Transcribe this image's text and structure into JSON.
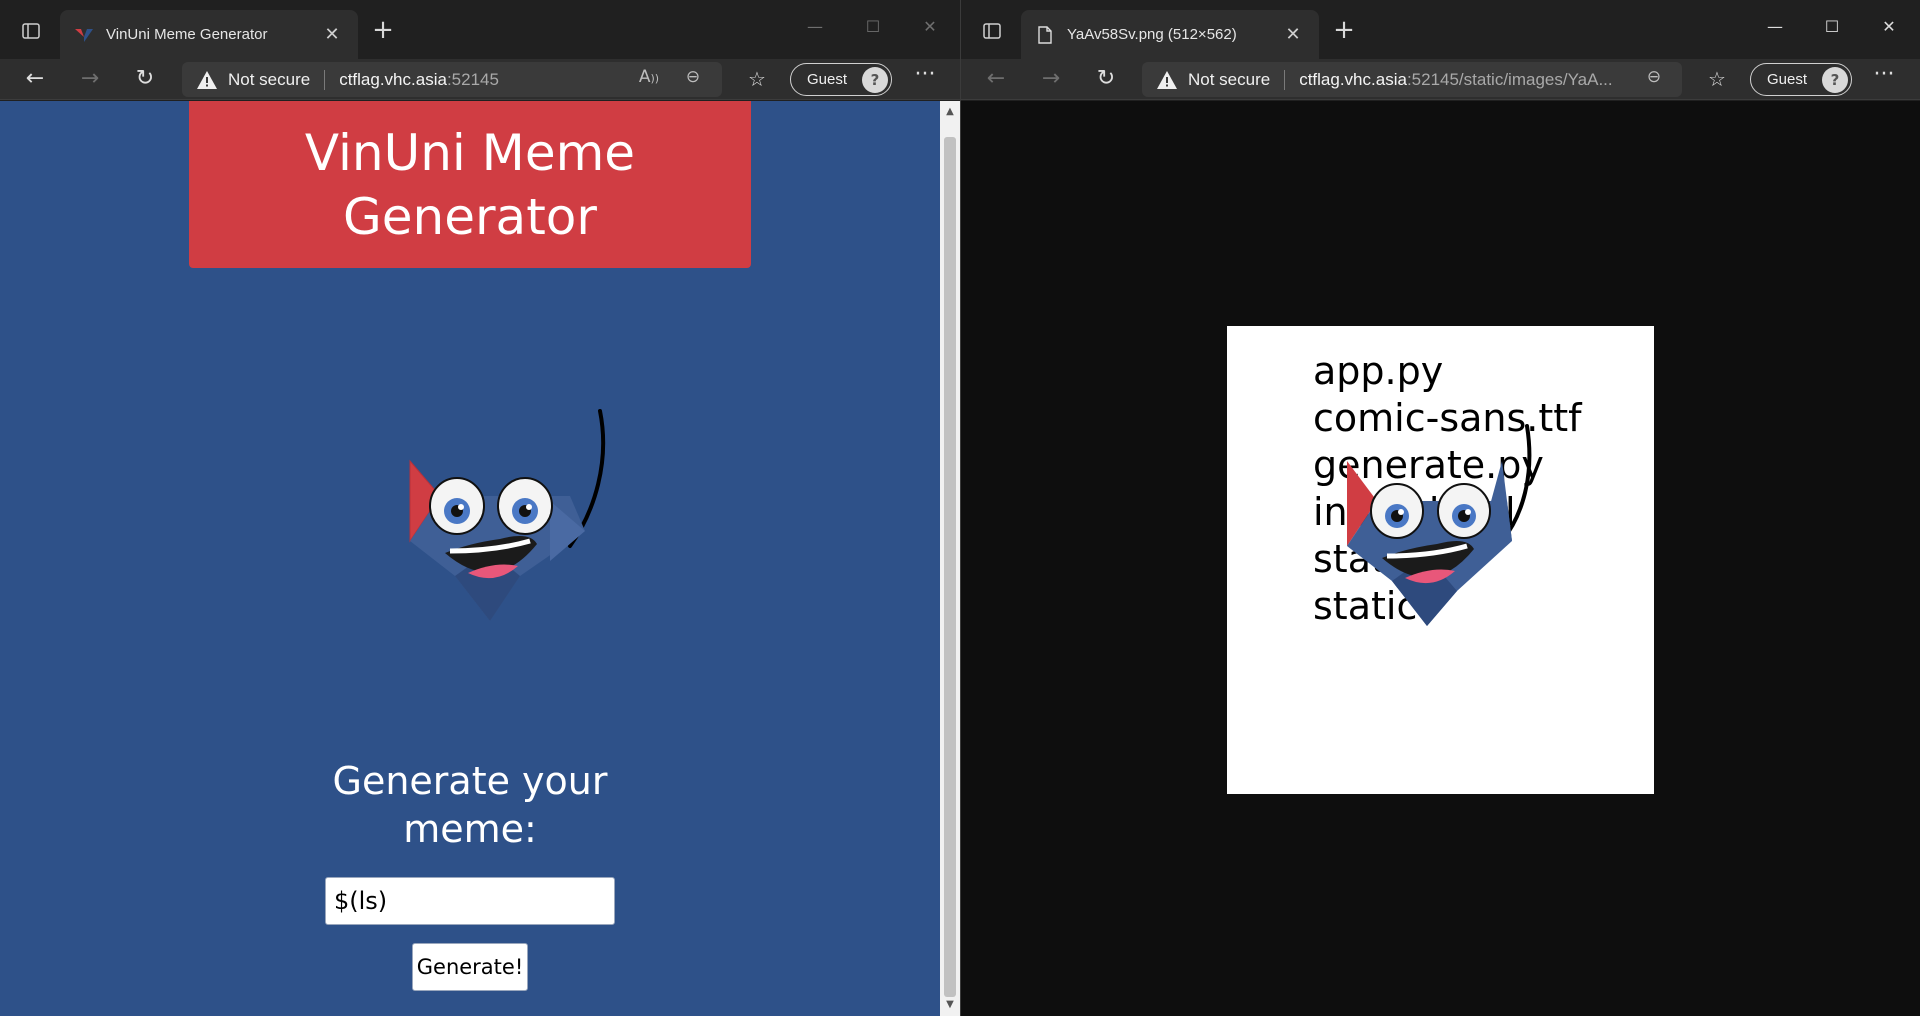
{
  "left_window": {
    "tab": {
      "title": "VinUni Meme Generator"
    },
    "address": {
      "security_label": "Not secure",
      "host": "ctflag.vhc.asia",
      "rest": ":52145"
    },
    "profile": {
      "label": "Guest"
    },
    "page": {
      "title": "VinUni Meme Generator",
      "heading": "Generate your meme:",
      "input_value": "$(ls)",
      "button_label": "Generate!"
    }
  },
  "right_window": {
    "tab": {
      "title": "YaAv58Sv.png (512×562)"
    },
    "address": {
      "security_label": "Not secure",
      "host": "ctflag.vhc.asia",
      "rest": ":52145/static/images/YaA..."
    },
    "profile": {
      "label": "Guest"
    },
    "image_text_lines": [
      "app.py",
      "comic-sans.ttf",
      "generate.py",
      "index.html",
      "static",
      "static"
    ]
  },
  "icons": {
    "tab_actions": "tab-actions-icon",
    "close": "close-icon",
    "new_tab": "plus-icon",
    "back": "back-arrow-icon",
    "forward": "forward-arrow-icon",
    "refresh": "refresh-icon",
    "warning": "warning-icon",
    "read_aloud": "read-aloud-icon",
    "zoom": "zoom-out-icon",
    "favorites": "favorites-icon",
    "more": "more-icon"
  },
  "colors": {
    "page_bg": "#2e5189",
    "title_card": "#d03d43",
    "browser_chrome": "#202020",
    "toolbar": "#2e2e2e",
    "image_viewer_bg": "#0e0e0e"
  }
}
